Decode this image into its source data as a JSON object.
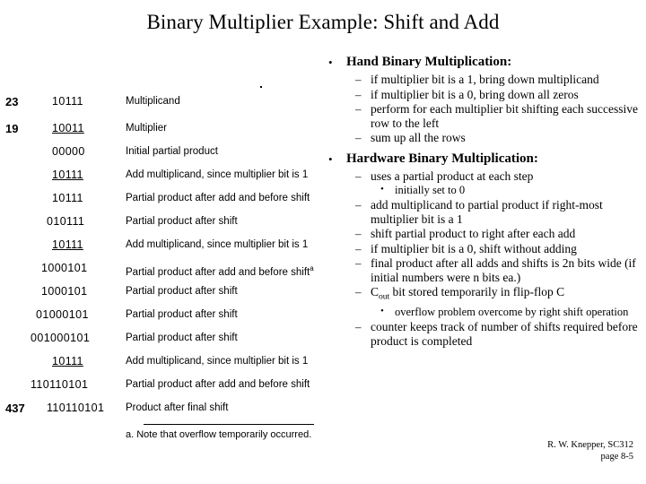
{
  "title": "Binary Multiplier Example:  Shift and Add",
  "figure": {
    "rows": [
      {
        "dec": "23",
        "bits": "10111",
        "label": "Multiplicand",
        "underline": false
      },
      {
        "dec": "19",
        "bits": "10011",
        "label": "Multiplier",
        "underline": false
      },
      {
        "dec": "",
        "bits": "00000",
        "label": "Initial partial product",
        "underline": false
      },
      {
        "dec": "",
        "bits": "10111",
        "label": "Add multiplicand, since multiplier bit is 1",
        "underline": true
      },
      {
        "dec": "",
        "bits": "10111",
        "label": "Partial product after add and before shift",
        "underline": false
      },
      {
        "dec": "",
        "bits": "010111",
        "label": "Partial product after shift",
        "underline": false
      },
      {
        "dec": "",
        "bits": "10111",
        "label": "Add multiplicand, since multiplier bit is 1",
        "underline": true
      },
      {
        "dec": "",
        "bits": "1000101",
        "label": "Partial product after add and before shift",
        "sup": "a",
        "underline": false
      },
      {
        "dec": "",
        "bits": "1000101",
        "label": "Partial product after shift",
        "underline": false
      },
      {
        "dec": "",
        "bits": "01000101",
        "label": "Partial product after shift",
        "underline": false
      },
      {
        "dec": "",
        "bits": "001000101",
        "label": "Partial product after shift",
        "underline": false
      },
      {
        "dec": "",
        "bits": "10111",
        "label": "Add multiplicand, since multiplier bit is 1",
        "underline": true
      },
      {
        "dec": "",
        "bits": "110110101",
        "label": "Partial product after add and before shift",
        "underline": false
      },
      {
        "dec": "437",
        "bits": "110110101",
        "label": "Product after final shift",
        "underline": false
      }
    ],
    "note": "a. Note that overflow temporarily occurred."
  },
  "bullets": {
    "hand": {
      "heading": "Hand Binary Multiplication:",
      "items": [
        "if multiplier bit is a 1, bring down multiplicand",
        "if multiplier bit is a 0, bring down all zeros",
        "perform for each multiplier bit shifting each successive row to the left",
        "sum up all the rows"
      ]
    },
    "hardware": {
      "heading": "Hardware Binary Multiplication:",
      "item1": "uses a partial product at each step",
      "item1_sub": "initially set to 0",
      "item2": "add multiplicand to partial product if right-most multiplier bit is a 1",
      "item3": "shift partial product to right after each add",
      "item4": "if multiplier bit is a 0, shift without adding",
      "item5": "final product after all adds and shifts is 2n bits wide (if initial numbers were n bits ea.)",
      "item6_pre": "C",
      "item6_sub": "out",
      "item6_post": " bit stored temporarily in flip-flop C",
      "item6_sub_bullet": "overflow problem overcome by right shift operation",
      "item7": "counter keeps track of number of shifts required before product is completed"
    },
    "bullet_lvl1": "•",
    "bullet_lvl2": "–",
    "bullet_lvl3": "•"
  },
  "footer": {
    "line1": "R. W. Knepper, SC312",
    "line2": "page 8-5"
  }
}
